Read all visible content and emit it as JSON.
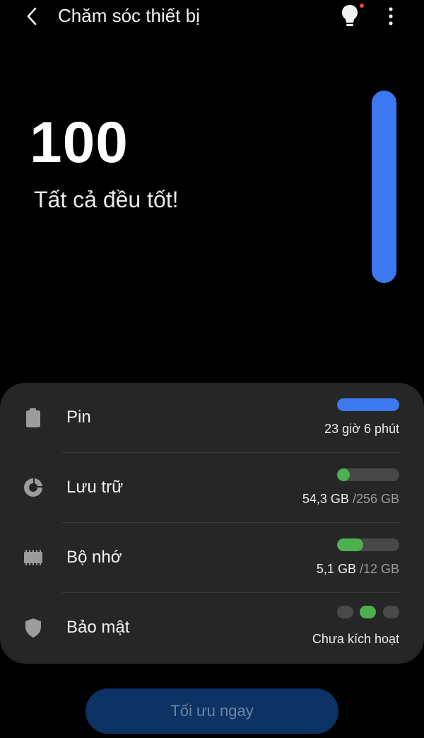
{
  "header": {
    "title": "Chăm sóc thiết bị",
    "back_icon": "chevron-left-icon",
    "tips_icon": "lightbulb-icon",
    "more_icon": "more-vertical-icon",
    "notification_color": "#e54848"
  },
  "score": {
    "value": "100",
    "status": "Tất cả đều tốt!",
    "level_fraction": 1.0,
    "bar_color": "#3c78f0"
  },
  "items": [
    {
      "label": "Pin",
      "icon": "battery-icon",
      "value": "23 giờ 6 phút",
      "level_fraction": 1.0,
      "bar_color": "#3c78f0"
    },
    {
      "label": "Lưu trữ",
      "icon": "storage-pie-icon",
      "used": "54,3 GB",
      "total": "/256 GB",
      "level_fraction": 0.21,
      "bar_color": "#4caf50"
    },
    {
      "label": "Bộ nhớ",
      "icon": "memory-chip-icon",
      "used": "5,1 GB",
      "total": "/12 GB",
      "level_fraction": 0.425,
      "bar_color": "#4caf50"
    },
    {
      "label": "Bảo mật",
      "icon": "shield-icon",
      "value": "Chưa kích hoạt",
      "active_dot_index": 1,
      "active_color": "#4caf50"
    }
  ],
  "button": {
    "label": "Tối ưu ngay"
  }
}
